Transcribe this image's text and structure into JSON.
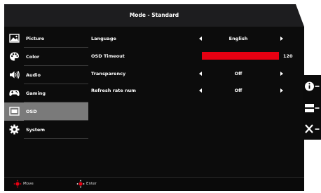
{
  "header": {
    "title": "Mode - Standard"
  },
  "sidebar": {
    "items": [
      {
        "label": "Picture",
        "icon": "picture-icon"
      },
      {
        "label": "Color",
        "icon": "palette-icon"
      },
      {
        "label": "Audio",
        "icon": "speaker-icon"
      },
      {
        "label": "Gaming",
        "icon": "gamepad-icon"
      },
      {
        "label": "OSD",
        "icon": "osd-icon",
        "selected": true
      },
      {
        "label": "System",
        "icon": "gear-icon"
      }
    ]
  },
  "settings": {
    "language": {
      "label": "Language",
      "value": "English"
    },
    "osd_timeout": {
      "label": "OSD Timeout",
      "value": "120",
      "max": 120
    },
    "transparency": {
      "label": "Transparency",
      "value": "Off"
    },
    "refresh_rate_num": {
      "label": "Refresh rate num",
      "value": "Off"
    }
  },
  "footer": {
    "move_label": "Move",
    "enter_label": "Enter"
  },
  "side_keys": [
    "info-icon",
    "input-icon",
    "close-icon"
  ],
  "colors": {
    "accent": "#e60012",
    "selected": "#7a7a7a",
    "background": "#0c0c0c",
    "header": "#1d1d1f"
  }
}
